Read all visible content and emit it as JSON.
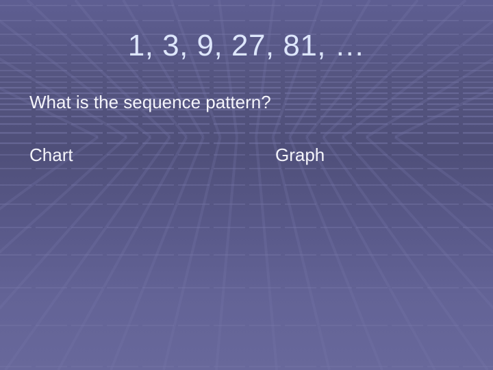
{
  "slide": {
    "title": "1, 3, 9, 27, 81, …",
    "question": "What is the sequence pattern?",
    "columns": [
      {
        "label": "Chart"
      },
      {
        "label": "Graph"
      }
    ]
  },
  "theme": {
    "background_color": "#5a5a8a",
    "title_color": "#dde6fb",
    "text_color": "#f4f4fa",
    "grid_line_color": "#7878aa"
  }
}
